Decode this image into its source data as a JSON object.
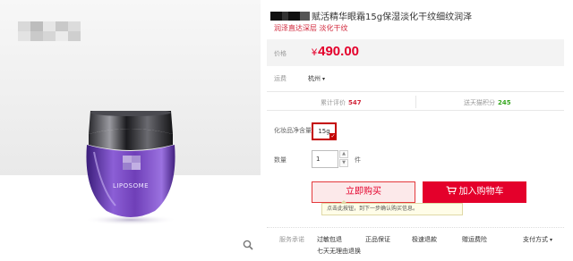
{
  "product": {
    "title": "赋活精华眼霜15g保湿淡化干纹细纹润泽",
    "subtitle": "润泽直达深层 淡化干纹",
    "image_brand": "LIPOSOME"
  },
  "price": {
    "label": "价格",
    "currency": "¥",
    "value": "490.00",
    "color": "#e4002b"
  },
  "shipping": {
    "label": "运费",
    "city": "杭州"
  },
  "stats": {
    "reviews_label": "累计评价",
    "reviews_count": "547",
    "points_label": "送天猫积分",
    "points_value": "245"
  },
  "spec": {
    "label": "化妆品净含量",
    "selected": "15g"
  },
  "quantity": {
    "label": "数量",
    "value": "1",
    "unit": "件"
  },
  "actions": {
    "buy_now": "立即购买",
    "add_to_cart": "加入购物车",
    "tooltip": "点击此按钮，到下一步确认购买信息。"
  },
  "services": {
    "label": "服务承诺",
    "items": [
      "过敏包退",
      "正品保证",
      "极速退款",
      "赠运费险"
    ],
    "extra": "七天无理由退换",
    "payment": "支付方式"
  },
  "icons": {
    "zoom": "magnifier-icon",
    "cart": "cart-icon",
    "caret": "chevron-down-icon",
    "check": "check-icon"
  },
  "colors": {
    "accent": "#e4002b",
    "points": "#34a61d",
    "jar_purple": "#6f3fb8"
  }
}
